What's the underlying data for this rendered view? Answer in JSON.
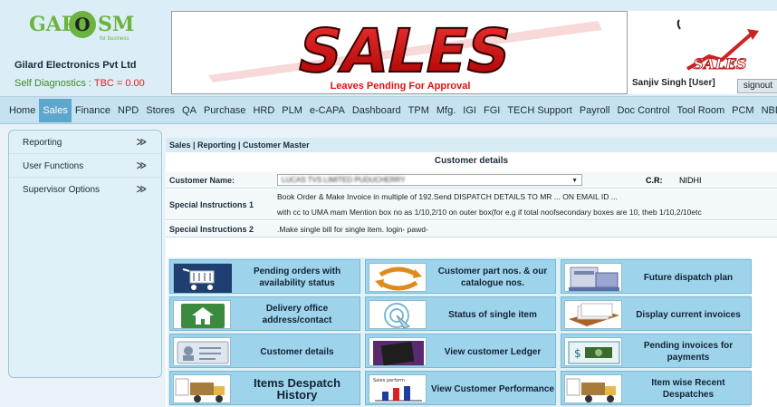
{
  "header": {
    "logo": {
      "gap": "GAP",
      "o": "O",
      "sm": "SM",
      "tagline": "for business"
    },
    "company": "Gilard Electronics Pvt Ltd",
    "diagnostics_label": "Self Diagnostics : ",
    "diagnostics_value": "TBC = 0.00",
    "banner_word": "SALES",
    "banner_notice": "Leaves Pending For Approval",
    "user": "Sanjiv Singh [User]",
    "signout": "signout",
    "corner_logo_text": "SALES"
  },
  "nav": [
    "Home",
    "Sales",
    "Finance",
    "NPD",
    "Stores",
    "QA",
    "Purchase",
    "HRD",
    "PLM",
    "e-CAPA",
    "Dashboard",
    "TPM",
    "Mfg.",
    "IGI",
    "FGI",
    "TECH Support",
    "Payroll",
    "Doc Control",
    "Tool Room",
    "PCM",
    "NBD"
  ],
  "nav_active": "Sales",
  "sidebar": [
    {
      "label": "Reporting",
      "arrow": "≫"
    },
    {
      "label": "User Functions",
      "arrow": "≫"
    },
    {
      "label": "Supervisor Options",
      "arrow": "≫"
    }
  ],
  "main": {
    "breadcrumb": "Sales | Reporting | Customer Master",
    "section_title": "Customer details",
    "customer_label": "Customer Name:",
    "customer_value": "LUCAS TVS LIMITED PUDUCHERRY",
    "cr_label": "C.R:",
    "cr_value": "NIDHI",
    "si1_label": "Special Instructions 1",
    "si1_line1": "Book Order & Make Invoice in multiple of 192.Send DISPATCH DETAILS TO MR ... ON EMAIL ID ...",
    "si1_line2": "with cc to UMA mam Mention box no as 1/10,2/10 on outer box(for e.g if total noofsecondary boxes are 10, theb 1/10,2/10etc",
    "si2_label": "Special Instructions 2",
    "si2_value": ".Make single bill for single item. login- pawd-"
  },
  "tiles": [
    {
      "label": "Pending orders with availability status",
      "icon": "shopping-cart-icon"
    },
    {
      "label": "Customer part nos. & our catalogue nos.",
      "icon": "exchange-arrows-icon"
    },
    {
      "label": "Future dispatch plan",
      "icon": "shipping-boxes-icon"
    },
    {
      "label": "Delivery office address/contact",
      "icon": "home-address-icon"
    },
    {
      "label": "Status of single item",
      "icon": "touch-status-icon"
    },
    {
      "label": "Display current invoices",
      "icon": "invoices-stack-icon"
    },
    {
      "label": "Customer details",
      "icon": "id-card-icon"
    },
    {
      "label": "View customer Ledger",
      "icon": "ledger-book-icon"
    },
    {
      "label": "Pending invoices for payments",
      "icon": "payment-icon"
    },
    {
      "label": "Items Despatch History",
      "icon": "despatch-truck-icon"
    },
    {
      "label": "View Customer Performance",
      "icon": "performance-chart-icon"
    },
    {
      "label": "Item wise Recent Despatches",
      "icon": "recent-truck-icon"
    }
  ],
  "tile_chart_caption": "Sales perform"
}
